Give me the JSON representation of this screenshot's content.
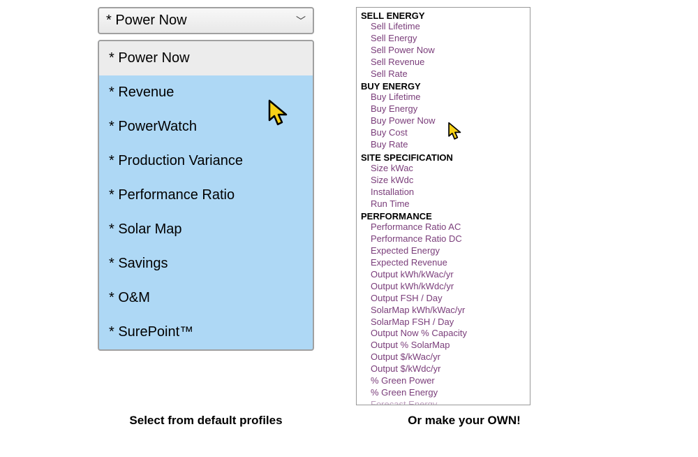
{
  "dropdown": {
    "selected": "* Power Now",
    "items": [
      "* Power Now",
      "* Revenue",
      "* PowerWatch",
      "* Production Variance",
      "* Performance Ratio",
      "* Solar Map",
      "* Savings",
      "* O&M",
      "* SurePoint™"
    ]
  },
  "categories": {
    "sell_energy": {
      "header": "SELL ENERGY",
      "items": [
        "Sell Lifetime",
        "Sell Energy",
        "Sell Power Now",
        "Sell Revenue",
        "Sell Rate"
      ]
    },
    "buy_energy": {
      "header": "BUY ENERGY",
      "items": [
        "Buy Lifetime",
        "Buy Energy",
        "Buy Power Now",
        "Buy Cost",
        "Buy Rate"
      ]
    },
    "site_spec": {
      "header": "SITE SPECIFICATION",
      "items": [
        "Size kWac",
        "Size kWdc",
        "Installation",
        "Run Time"
      ]
    },
    "performance": {
      "header": "PERFORMANCE",
      "items": [
        "Performance Ratio AC",
        "Performance Ratio DC",
        "Expected Energy",
        "Expected Revenue",
        "Output kWh/kWac/yr",
        "Output kWh/kWdc/yr",
        "Output FSH / Day",
        "SolarMap kWh/kWac/yr",
        "SolarMap FSH / Day",
        "Output Now % Capacity",
        "Output % SolarMap",
        "Output $/kWac/yr",
        "Output $/kWdc/yr",
        "% Green Power",
        "% Green Energy",
        "Forecast Energy"
      ]
    }
  },
  "captions": {
    "left": "Select from default profiles",
    "right": "Or make your OWN!"
  }
}
